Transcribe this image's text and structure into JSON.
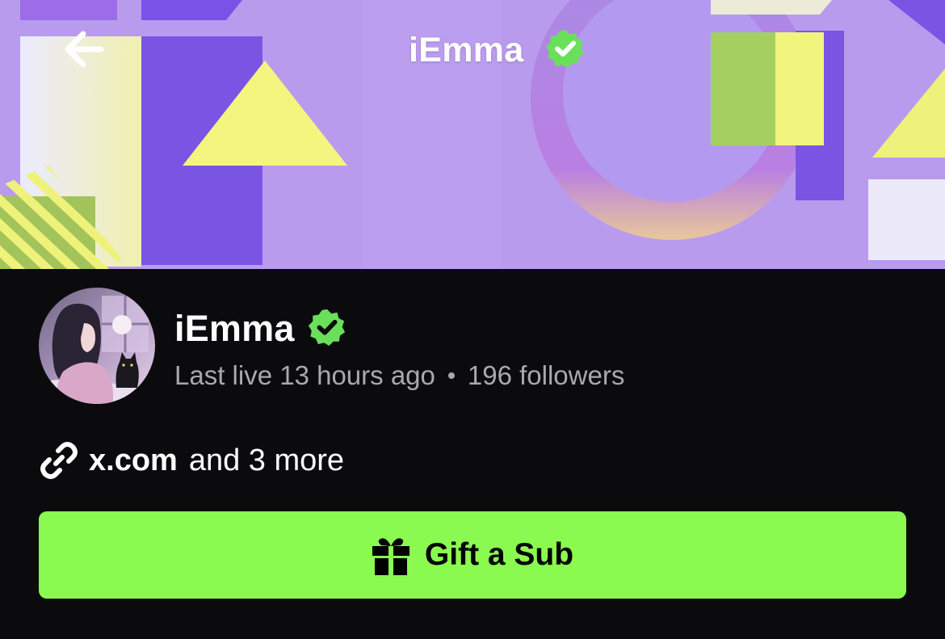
{
  "header": {
    "title": "iEmma",
    "back_icon": "arrow-left-icon",
    "verified_icon": "verified-badge-icon"
  },
  "profile": {
    "name": "iEmma",
    "last_live": "Last live 13 hours ago",
    "followers": "196 followers",
    "avatar": "anime-girl-with-cat-avatar"
  },
  "links": {
    "primary": "x.com",
    "more": "and 3 more",
    "icon": "link-icon"
  },
  "action": {
    "label": "Gift a Sub",
    "icon": "gift-icon"
  },
  "colors": {
    "accent": "#8afa51",
    "background": "#0b0b0d",
    "banner": "#b99bee",
    "muted_text": "#a8a8b0"
  }
}
